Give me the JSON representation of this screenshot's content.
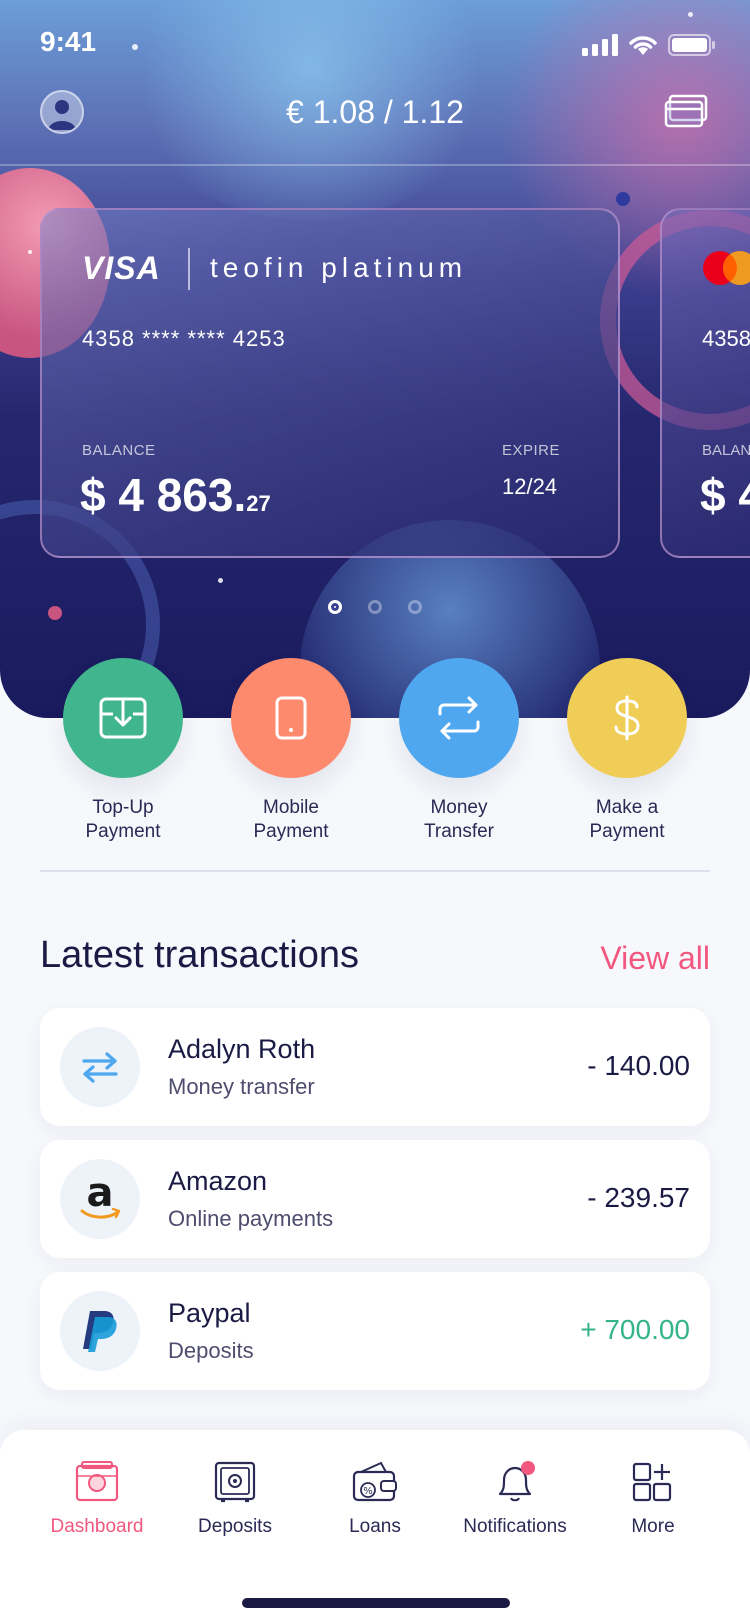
{
  "status_bar": {
    "time": "9:41"
  },
  "header": {
    "rate": "€ 1.08 / 1.12"
  },
  "cards": [
    {
      "brand": "VISA",
      "name": "teofin platinum",
      "number": "4358 **** **** 4253",
      "balance_label": "BALANCE",
      "balance_main": "$ 4 863.",
      "balance_cents": "27",
      "expire_label": "EXPIRE",
      "expire_value": "12/24"
    },
    {
      "brand": "mastercard",
      "number": "4358",
      "balance_label": "BALAN",
      "balance_main": "$ 4"
    }
  ],
  "pager": {
    "count": 3,
    "active": 0
  },
  "actions": [
    {
      "label_line1": "Top-Up",
      "label_line2": "Payment",
      "icon": "top-up-icon",
      "color": "#41B68E"
    },
    {
      "label_line1": "Mobile",
      "label_line2": "Payment",
      "icon": "mobile-icon",
      "color": "#FE8A6E"
    },
    {
      "label_line1": "Money",
      "label_line2": "Transfer",
      "icon": "transfer-icon",
      "color": "#4FA8EF"
    },
    {
      "label_line1": "Make a",
      "label_line2": "Payment",
      "icon": "dollar-icon",
      "color": "#F0CD56"
    }
  ],
  "transactions_section": {
    "title": "Latest transactions",
    "view_all": "View all"
  },
  "transactions": [
    {
      "name": "Adalyn Roth",
      "type": "Money transfer",
      "amount": "- 140.00",
      "icon": "transfer-icon"
    },
    {
      "name": "Amazon",
      "type": "Online payments",
      "amount": "- 239.57",
      "icon": "amazon-logo-icon"
    },
    {
      "name": "Paypal",
      "type": "Deposits",
      "amount": "+ 700.00",
      "icon": "paypal-logo-icon"
    }
  ],
  "tabbar": {
    "items": [
      {
        "label": "Dashboard",
        "icon": "dashboard-icon",
        "active": true
      },
      {
        "label": "Deposits",
        "icon": "safe-icon",
        "active": false
      },
      {
        "label": "Loans",
        "icon": "wallet-icon",
        "active": false
      },
      {
        "label": "Notifications",
        "icon": "bell-icon",
        "active": false,
        "badge": true
      },
      {
        "label": "More",
        "icon": "grid-plus-icon",
        "active": false
      }
    ]
  },
  "colors": {
    "accent": "#F2587F",
    "positive": "#34B48A",
    "text": "#1B1A45"
  }
}
